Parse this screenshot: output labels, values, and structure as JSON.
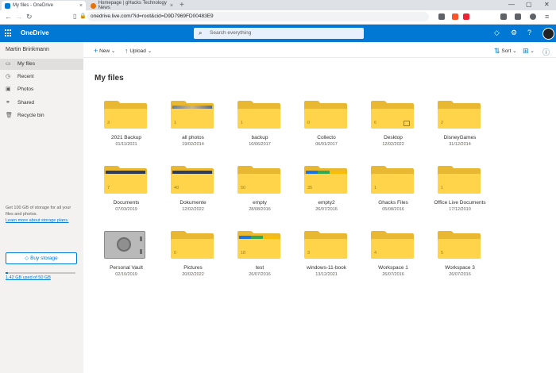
{
  "browser": {
    "tabs": [
      {
        "title": "My files - OneDrive"
      },
      {
        "title": "Homepage | gHacks Technology News"
      }
    ],
    "url": "onedrive.live.com/?id=root&cid=D9D7969FD00483E9"
  },
  "app": {
    "brand": "OneDrive",
    "search_placeholder": "Search everything",
    "accent": "#0078d4"
  },
  "sidebar": {
    "user": "Martin Brinkmann",
    "items": [
      {
        "label": "My files",
        "icon": "folder-icon",
        "selected": true
      },
      {
        "label": "Recent",
        "icon": "clock-icon"
      },
      {
        "label": "Photos",
        "icon": "photo-icon"
      },
      {
        "label": "Shared",
        "icon": "share-icon"
      },
      {
        "label": "Recycle bin",
        "icon": "trash-icon"
      }
    ],
    "promo_text": "Get 100 GB of storage for all your files and photos.",
    "promo_link": "Learn more about storage plans.",
    "buy_label": "Buy storage",
    "quota_text": "1.42 GB used of 50 GB",
    "quota_fraction": 0.03
  },
  "commands": {
    "new_label": "New",
    "upload_label": "Upload",
    "sort_label": "Sort"
  },
  "main": {
    "title": "My files",
    "items": [
      {
        "name": "2021 Backup",
        "date": "01/11/2021",
        "count": "3"
      },
      {
        "name": "all photos",
        "date": "19/02/2014",
        "count": "1",
        "thumb": "photo"
      },
      {
        "name": "backup",
        "date": "10/06/2017",
        "count": "1"
      },
      {
        "name": "Collecto",
        "date": "06/01/2017",
        "count": "0"
      },
      {
        "name": "Desktop",
        "date": "12/02/2022",
        "count": "6",
        "badge": true
      },
      {
        "name": "DisneyGames",
        "date": "31/12/2014",
        "count": "2"
      },
      {
        "name": "Documents",
        "date": "07/03/2019",
        "count": "7",
        "thumb": "doc"
      },
      {
        "name": "Dokumente",
        "date": "12/02/2022",
        "count": "40",
        "thumb": "doc"
      },
      {
        "name": "empty",
        "date": "28/08/2016",
        "count": "50"
      },
      {
        "name": "empty2",
        "date": "26/07/2016",
        "count": "35",
        "thumb": "tiles"
      },
      {
        "name": "Ghacks Files",
        "date": "05/08/2016",
        "count": "1"
      },
      {
        "name": "Office Live Documents",
        "date": "17/12/2010",
        "count": "1"
      },
      {
        "name": "Personal Vault",
        "date": "02/10/2019",
        "vault": true
      },
      {
        "name": "Pictures",
        "date": "20/02/2022",
        "count": "0"
      },
      {
        "name": "test",
        "date": "26/07/2016",
        "count": "18",
        "thumb": "tiles"
      },
      {
        "name": "windows-11-book",
        "date": "13/12/2021",
        "count": "3"
      },
      {
        "name": "Workspace 1",
        "date": "26/07/2016",
        "count": "4"
      },
      {
        "name": "Workspace 3",
        "date": "26/07/2016",
        "count": "5"
      }
    ]
  }
}
